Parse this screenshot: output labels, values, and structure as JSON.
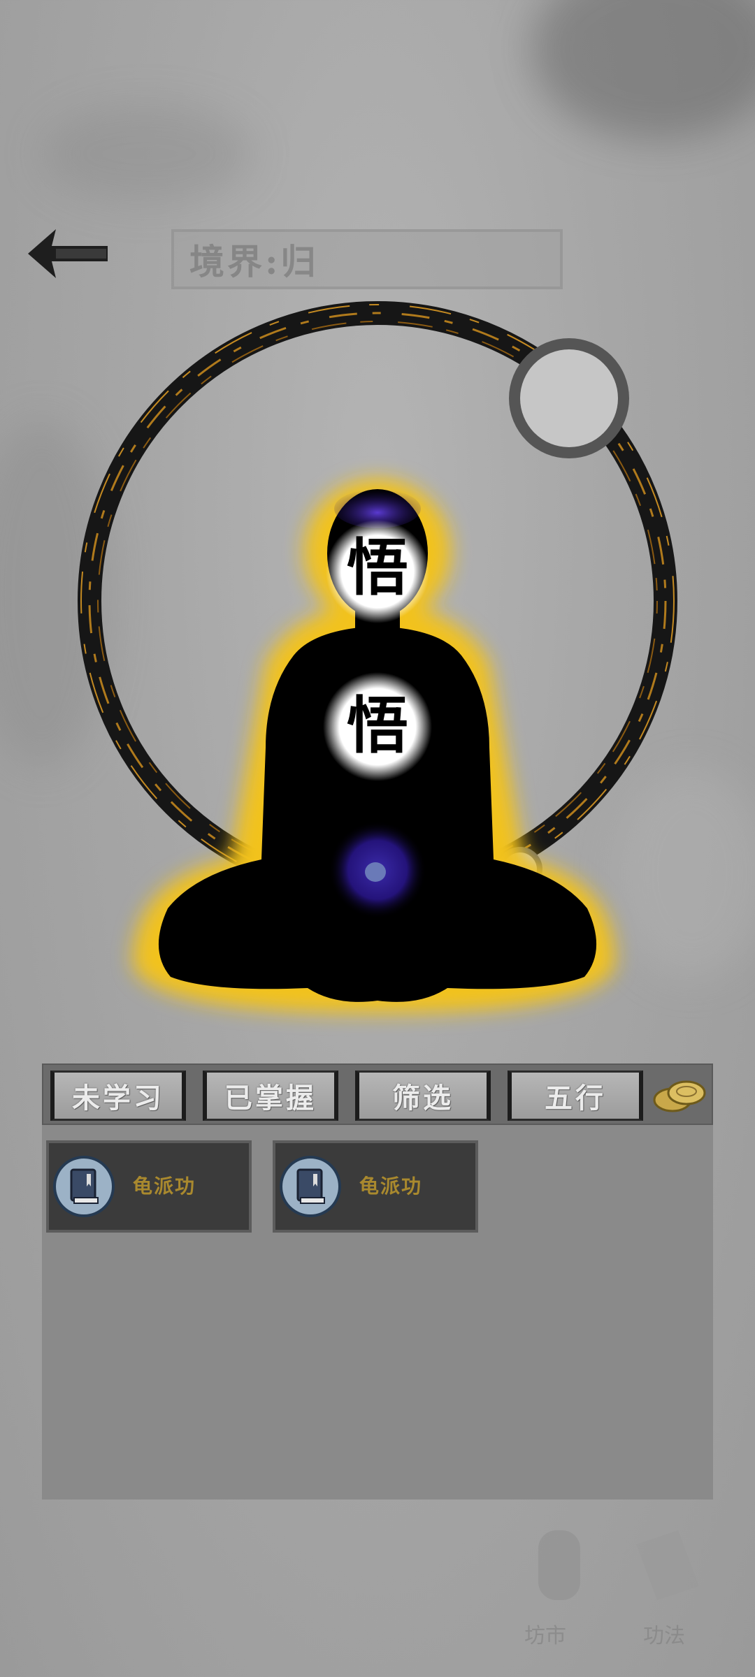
{
  "header": {
    "realm_label": "境界:归",
    "back_icon": "left-arrow-icon"
  },
  "figure": {
    "head_glyph": "悟",
    "chest_glyph": "悟",
    "aura_color": "#f2c21a",
    "ring_color": "#b07a1c",
    "dantian_color": "#2a1a8c"
  },
  "tabs": [
    {
      "label": "未学习"
    },
    {
      "label": "已掌握"
    },
    {
      "label": "筛选"
    },
    {
      "label": "五行"
    }
  ],
  "coin_icon": "coins-icon",
  "skills": [
    {
      "name": "龟派功",
      "icon": "book-icon"
    },
    {
      "name": "龟派功",
      "icon": "book-icon"
    }
  ],
  "bottom_nav": [
    {
      "label": "坊市",
      "icon": "scroll-icon"
    },
    {
      "label": "功法",
      "icon": "book-icon"
    }
  ]
}
